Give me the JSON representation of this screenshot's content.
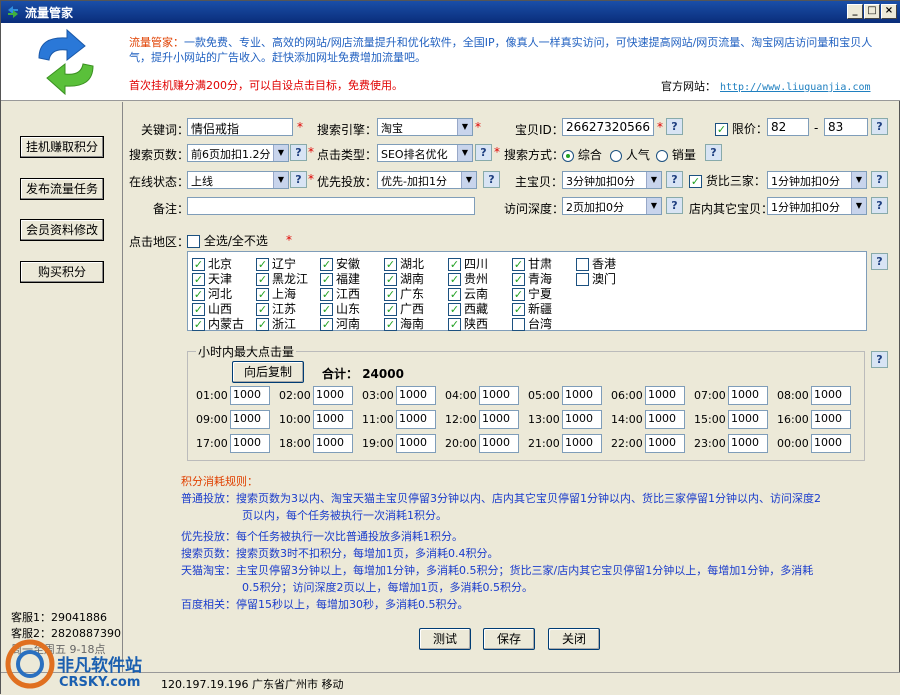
{
  "window": {
    "title": "流量管家"
  },
  "header": {
    "brand": "流量管家：",
    "description": "一款免费、专业、高效的网站/网店流量提升和优化软件，全国IP，像真人一样真实访问，可快速提高网站/网页流量、淘宝网店访问量和宝贝人气，提升小网站的广告收入。赶快添加网址免费增加流量吧。",
    "promo": "首次挂机赚分满200分，可以自设点击目标，免费使用。",
    "site_label": "官方网站：",
    "site_url": "http://www.liuguanjia.com"
  },
  "sidebar": {
    "buttons": [
      "挂机赚取积分",
      "发布流量任务",
      "会员资料修改",
      "购买积分"
    ],
    "kefu1": "客服1：29041886",
    "kefu2": "客服2：2820887390",
    "hours": "周一至周五 9-18点"
  },
  "form": {
    "keyword_label": "关键词：",
    "keyword_value": "情侣戒指",
    "engine_label": "搜索引擎：",
    "engine_value": "淘宝",
    "itemid_label": "宝贝ID：",
    "itemid_value": "26627320566",
    "price_label": "限价：",
    "price_min": "82",
    "price_sep": "-",
    "price_max": "83",
    "pages_label": "搜索页数：",
    "pages_value": "前6页加扣1.2分",
    "clicktype_label": "点击类型：",
    "clicktype_value": "SEO排名优化",
    "searchmode_label": "搜索方式：",
    "mode1": "综合",
    "mode2": "人气",
    "mode3": "销量",
    "online_label": "在线状态：",
    "online_value": "上线",
    "priority_label": "优先投放：",
    "priority_value": "优先-加扣1分",
    "main_label": "主宝贝：",
    "main_value": "3分钟加扣0分",
    "compare_label": "货比三家：",
    "compare_value": "1分钟加扣0分",
    "note_label": "备注：",
    "note_value": "",
    "depth_label": "访问深度：",
    "depth_value": "2页加扣0分",
    "other_label": "店内其它宝贝：",
    "other_value": "1分钟加扣0分",
    "region_label": "点击地区：",
    "selectall_label": "全选/全不选",
    "regions": [
      {
        "name": "北京",
        "on": true
      },
      {
        "name": "天津",
        "on": true
      },
      {
        "name": "河北",
        "on": true
      },
      {
        "name": "山西",
        "on": true
      },
      {
        "name": "内蒙古",
        "on": true
      },
      {
        "name": "辽宁",
        "on": true
      },
      {
        "name": "黑龙江",
        "on": true
      },
      {
        "name": "上海",
        "on": true
      },
      {
        "name": "江苏",
        "on": true
      },
      {
        "name": "浙江",
        "on": true
      },
      {
        "name": "安徽",
        "on": true
      },
      {
        "name": "福建",
        "on": true
      },
      {
        "name": "江西",
        "on": true
      },
      {
        "name": "山东",
        "on": true
      },
      {
        "name": "河南",
        "on": true
      },
      {
        "name": "湖北",
        "on": true
      },
      {
        "name": "湖南",
        "on": true
      },
      {
        "name": "广东",
        "on": true
      },
      {
        "name": "广西",
        "on": true
      },
      {
        "name": "海南",
        "on": true
      },
      {
        "name": "四川",
        "on": true
      },
      {
        "name": "贵州",
        "on": true
      },
      {
        "name": "云南",
        "on": true
      },
      {
        "name": "西藏",
        "on": true
      },
      {
        "name": "陕西",
        "on": true
      },
      {
        "name": "甘肃",
        "on": true
      },
      {
        "name": "青海",
        "on": true
      },
      {
        "name": "宁夏",
        "on": true
      },
      {
        "name": "新疆",
        "on": true
      },
      {
        "name": "台湾",
        "on": false
      },
      {
        "name": "香港",
        "on": false
      },
      {
        "name": "澳门",
        "on": false
      }
    ]
  },
  "hourly": {
    "legend": "小时内最大点击量",
    "copy_button": "向后复制",
    "total_label": "合计：",
    "total": "24000",
    "hours": [
      "01:00",
      "02:00",
      "03:00",
      "04:00",
      "05:00",
      "06:00",
      "07:00",
      "08:00",
      "09:00",
      "10:00",
      "11:00",
      "12:00",
      "13:00",
      "14:00",
      "15:00",
      "16:00",
      "17:00",
      "18:00",
      "19:00",
      "20:00",
      "21:00",
      "22:00",
      "23:00",
      "00:00"
    ],
    "values": [
      "1000",
      "1000",
      "1000",
      "1000",
      "1000",
      "1000",
      "1000",
      "1000",
      "1000",
      "1000",
      "1000",
      "1000",
      "1000",
      "1000",
      "1000",
      "1000",
      "1000",
      "1000",
      "1000",
      "1000",
      "1000",
      "1000",
      "1000",
      "1000"
    ]
  },
  "rules": {
    "title": "积分消耗规则：",
    "line1a": "普通投放：搜索页数为3以内、淘宝天猫主宝贝停留3分钟以内、店内其它宝贝停留1分钟以内、货比三家停留1分钟以内、访问深度2",
    "line1b": "页以内，每个任务被执行一次消耗1积分。",
    "line2": "优先投放：每个任务被执行一次比普通投放多消耗1积分。",
    "line3": "搜索页数：搜索页数3时不扣积分，每增加1页，多消耗0.4积分。",
    "line4a": "天猫淘宝：主宝贝停留3分钟以上，每增加1分钟，多消耗0.5积分；货比三家/店内其它宝贝停留1分钟以上，每增加1分钟，多消耗",
    "line4b": "0.5积分；访问深度2页以上，每增加1页，多消耗0.5积分。",
    "line5": "百度相关：停留15秒以上，每增加30秒，多消耗0.5积分。"
  },
  "buttons": {
    "test": "测试",
    "save": "保存",
    "close": "关闭"
  },
  "status": {
    "ip": "120.197.19.196 广东省广州市 移动"
  },
  "watermark": {
    "text1": "非凡软件站",
    "text2": "CRSKY.com"
  }
}
